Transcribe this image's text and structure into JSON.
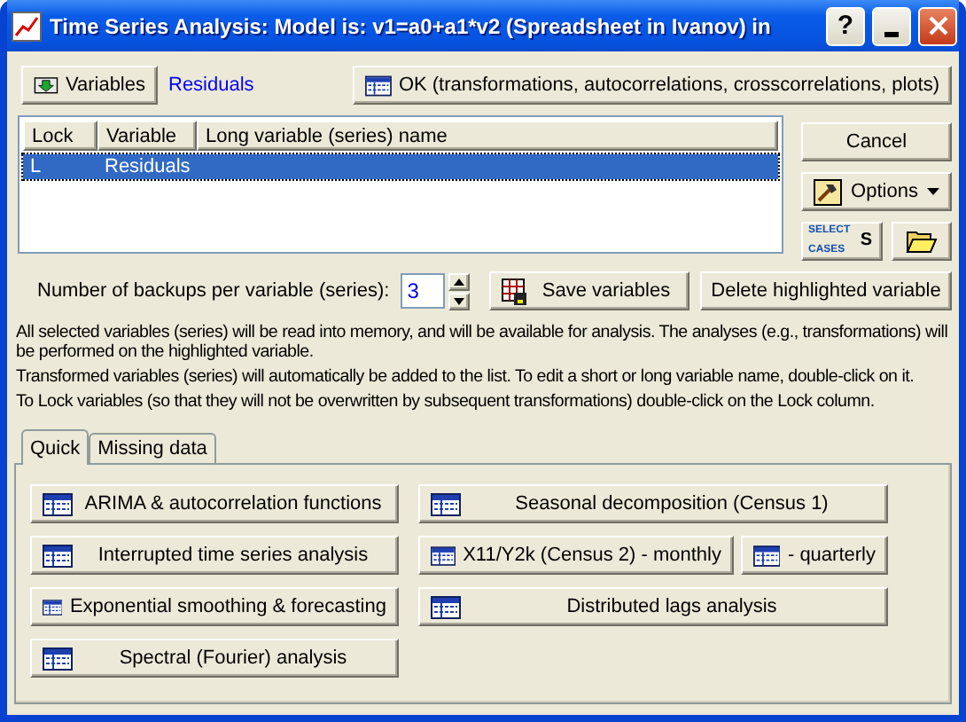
{
  "window": {
    "title": "Time Series Analysis: Model is: v1=a0+a1*v2 (Spreadsheet in Ivanov) in",
    "help_button": "?"
  },
  "variables_button": "Variables",
  "selected_variables": "Residuals",
  "ok_button": "OK (transformations, autocorrelations, crosscorrelations, plots)",
  "table": {
    "columns": [
      "Lock",
      "Variable",
      "Long variable (series) name"
    ],
    "rows": [
      {
        "lock": "L",
        "variable": "Residuals",
        "selected": true
      }
    ]
  },
  "cancel_button": "Cancel",
  "options_button": "Options",
  "select_cases": {
    "top": "SELECT",
    "bottom": "CASES",
    "symbol": "S"
  },
  "backups": {
    "label": "Number of backups per variable (series):",
    "value": "3"
  },
  "save_button": "Save variables",
  "delete_button": "Delete highlighted variable",
  "notes": [
    "All selected variables (series) will be read into memory, and will be available for analysis. The analyses (e.g., transformations) will be performed on the highlighted variable.",
    "Transformed variables (series) will automatically be added to the list. To edit a short or long variable name, double-click on it.",
    "To Lock variables (so that they will not be overwritten by subsequent transformations) double-click on the Lock column."
  ],
  "tabs": [
    {
      "label": "Quick",
      "selected": true
    },
    {
      "label": "Missing data",
      "selected": false
    }
  ],
  "analysis_buttons": {
    "left": [
      "ARIMA & autocorrelation functions",
      "Interrupted time series analysis",
      "Exponential smoothing & forecasting",
      "Spectral (Fourier) analysis"
    ],
    "right": [
      [
        "Seasonal decomposition (Census 1)"
      ],
      [
        "X11/Y2k (Census 2) - monthly",
        "- quarterly"
      ],
      [
        "Distributed lags analysis"
      ]
    ]
  }
}
